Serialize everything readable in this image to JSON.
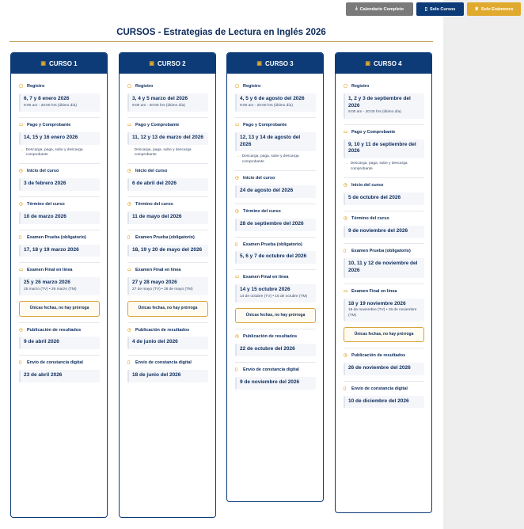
{
  "toolbar": {
    "calendar_label": "Calendario Completo",
    "courses_label": "Solo Cursos",
    "exams_label": "Solo Exámenes"
  },
  "page_title": "CURSOS - Estrategias de Lectura en Inglés 2026",
  "courses": [
    {
      "name": "CURSO 1",
      "registro": {
        "label": "Registro",
        "date": "6, 7 y 8 enero 2026",
        "sub": "9:00 am - 20:00 hrs (último día)"
      },
      "pago": {
        "label": "Pago y Comprobante",
        "date": "14, 15 y 16 enero 2026",
        "note": "Descarga, paga, sube y descarga comprobante"
      },
      "inicio": {
        "label": "Inicio del curso",
        "date": "3 de febrero 2026"
      },
      "termino": {
        "label": "Término del curso",
        "date": "10 de marzo 2026"
      },
      "prueba": {
        "label": "Examen Prueba (obligatorio)",
        "date": "17, 18 y 19 marzo 2026"
      },
      "final": {
        "label": "Examen Final en línea",
        "date": "25 y 26 marzo 2026",
        "sub": "25 marzo (TV) • 26 marzo (TM)",
        "warning": "Únicas fechas, no hay prórroga"
      },
      "resultados": {
        "label": "Publicación de resultados",
        "date": "9 de abril 2026"
      },
      "constancia": {
        "label": "Envío de constancia digital",
        "date": "23 de abril 2026"
      }
    },
    {
      "name": "CURSO 2",
      "registro": {
        "label": "Registro",
        "date": "3, 4 y 5 marzo del 2026",
        "sub": "9:00 am - 20:00 hrs (último día)"
      },
      "pago": {
        "label": "Pago y Comprobante",
        "date": "11, 12 y 13 de marzo del 2026",
        "note": "Descarga, paga, sube y descarga comprobante"
      },
      "inicio": {
        "label": "Inicio del curso",
        "date": "6 de abril del 2026"
      },
      "termino": {
        "label": "Término del curso",
        "date": "11 de mayo del 2026"
      },
      "prueba": {
        "label": "Examen Prueba (obligatorio)",
        "date": "18, 19 y 20 de mayo del 2026"
      },
      "final": {
        "label": "Examen Final en línea",
        "date": "27 y 28 mayo 2026",
        "sub": "27 de mayo (TV) • 28 de mayo (TM)",
        "warning": "Únicas fechas, no hay prórroga"
      },
      "resultados": {
        "label": "Publicación de resultados",
        "date": "4 de junio del 2026"
      },
      "constancia": {
        "label": "Envío de constancia digital",
        "date": "18 de junio del 2026"
      }
    },
    {
      "name": "CURSO 3",
      "registro": {
        "label": "Registro",
        "date": "4, 5 y 6 de agosto del 2026",
        "sub": "9:00 am - 20:00 hrs (último día)"
      },
      "pago": {
        "label": "Pago y Comprobante",
        "date": "12, 13 y 14 de agosto del 2026",
        "note": "Descarga, paga, sube y descarga comprobante"
      },
      "inicio": {
        "label": "Inicio del curso",
        "date": "24 de agosto del 2026"
      },
      "termino": {
        "label": "Término del curso",
        "date": "28 de septiembre del 2026"
      },
      "prueba": {
        "label": "Examen Prueba (obligatorio)",
        "date": "5, 6 y 7 de octubre del 2026"
      },
      "final": {
        "label": "Examen Final en línea",
        "date": "14 y 15 octubre 2026",
        "sub": "14 de octubre (TV) • 15 de octubre (TM)",
        "warning": "Únicas fechas, no hay prórroga"
      },
      "resultados": {
        "label": "Publicación de resultados",
        "date": "22 de octubre del 2026"
      },
      "constancia": {
        "label": "Envío de constancia digital",
        "date": "9 de noviembre del 2026"
      }
    },
    {
      "name": "CURSO 4",
      "registro": {
        "label": "Registro",
        "date": "1, 2 y 3 de septiembre del 2026",
        "sub": "9:00 am - 20:00 hrs (último día)"
      },
      "pago": {
        "label": "Pago y Comprobante",
        "date": "9, 10 y 11 de septiembre del 2026",
        "note": "Descarga, paga, sube y descarga comprobante"
      },
      "inicio": {
        "label": "Inicio del curso",
        "date": "5 de octubre del 2026"
      },
      "termino": {
        "label": "Término del curso",
        "date": "9 de noviembre del 2026"
      },
      "prueba": {
        "label": "Examen Prueba (obligatorio)",
        "date": "10, 11 y 12 de noviembre del 2026"
      },
      "final": {
        "label": "Examen Final en línea",
        "date": "18 y 19 noviembre 2026",
        "sub": "18 de noviembre (TV) • 19 de noviembre (TM)",
        "warning": "Únicas fechas, no hay prórroga"
      },
      "resultados": {
        "label": "Publicación de resultados",
        "date": "26 de noviembre del 2026"
      },
      "constancia": {
        "label": "Envío de constancia digital",
        "date": "10 de diciembre del 2026"
      }
    }
  ]
}
